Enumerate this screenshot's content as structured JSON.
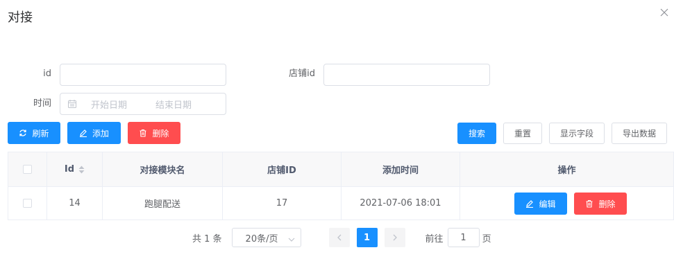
{
  "dialog": {
    "title": "对接",
    "close_icon": "close-icon"
  },
  "filters": {
    "id_label": "id",
    "id_value": "",
    "store_id_label": "店铺id",
    "store_id_value": "",
    "time_label": "时间",
    "start_placeholder": "开始日期",
    "end_placeholder": "结束日期"
  },
  "toolbar": {
    "refresh_label": "刷新",
    "add_label": "添加",
    "delete_label": "删除",
    "search_label": "搜索",
    "reset_label": "重置",
    "columns_label": "显示字段",
    "export_label": "导出数据"
  },
  "table": {
    "headers": {
      "id": "Id",
      "module_name": "对接模块名",
      "store_id": "店铺ID",
      "add_time": "添加时间",
      "actions": "操作"
    },
    "rows": [
      {
        "id": "14",
        "module_name": "跑腿配送",
        "store_id": "17",
        "add_time": "2021-07-06 18:01",
        "edit_label": "编辑",
        "delete_label": "删除"
      }
    ]
  },
  "pagination": {
    "total_text": "共 1 条",
    "page_size": "20条/页",
    "current_page": "1",
    "goto_label": "前往",
    "goto_value": "1",
    "page_unit": "页"
  },
  "colors": {
    "primary": "#1890ff",
    "danger": "#ff4d4f",
    "border": "#dcdfe6"
  }
}
